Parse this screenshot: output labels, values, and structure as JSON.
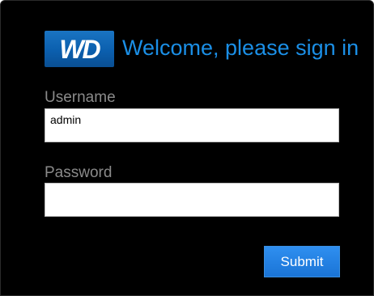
{
  "brand": {
    "logo_text": "WD",
    "icon": "wd-logo-icon",
    "color": "#0b5fae"
  },
  "header": {
    "welcome_text": "Welcome, please sign in",
    "color": "#1b8fe6"
  },
  "form": {
    "username": {
      "label": "Username",
      "value": "admin"
    },
    "password": {
      "label": "Password",
      "value": ""
    },
    "submit_label": "Submit"
  },
  "colors": {
    "background": "#000000",
    "label": "#8a8a8a",
    "button": "#1f7fe0"
  }
}
